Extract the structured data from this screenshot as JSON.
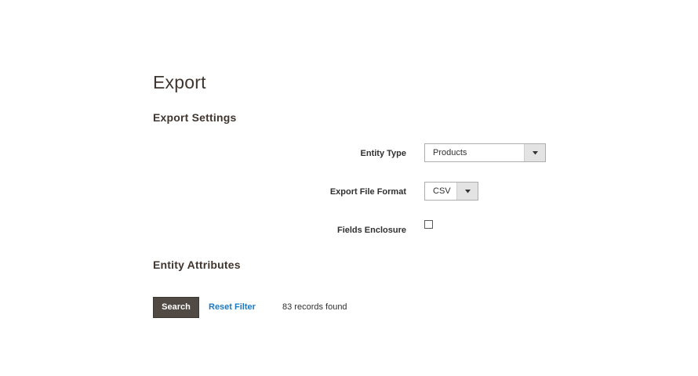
{
  "page": {
    "title": "Export"
  },
  "export_settings": {
    "heading": "Export Settings",
    "entity_type": {
      "label": "Entity Type",
      "value": "Products"
    },
    "file_format": {
      "label": "Export File Format",
      "value": "CSV"
    },
    "fields_enclosure": {
      "label": "Fields Enclosure",
      "checked": false
    }
  },
  "entity_attributes": {
    "heading": "Entity Attributes",
    "search_label": "Search",
    "reset_filter_label": "Reset Filter",
    "records_found": "83 records found"
  },
  "icons": {
    "select_arrow": "chevron-down-icon"
  },
  "colors": {
    "button_bg": "#514943",
    "link": "#1979c3",
    "heading_text": "#41362f"
  }
}
